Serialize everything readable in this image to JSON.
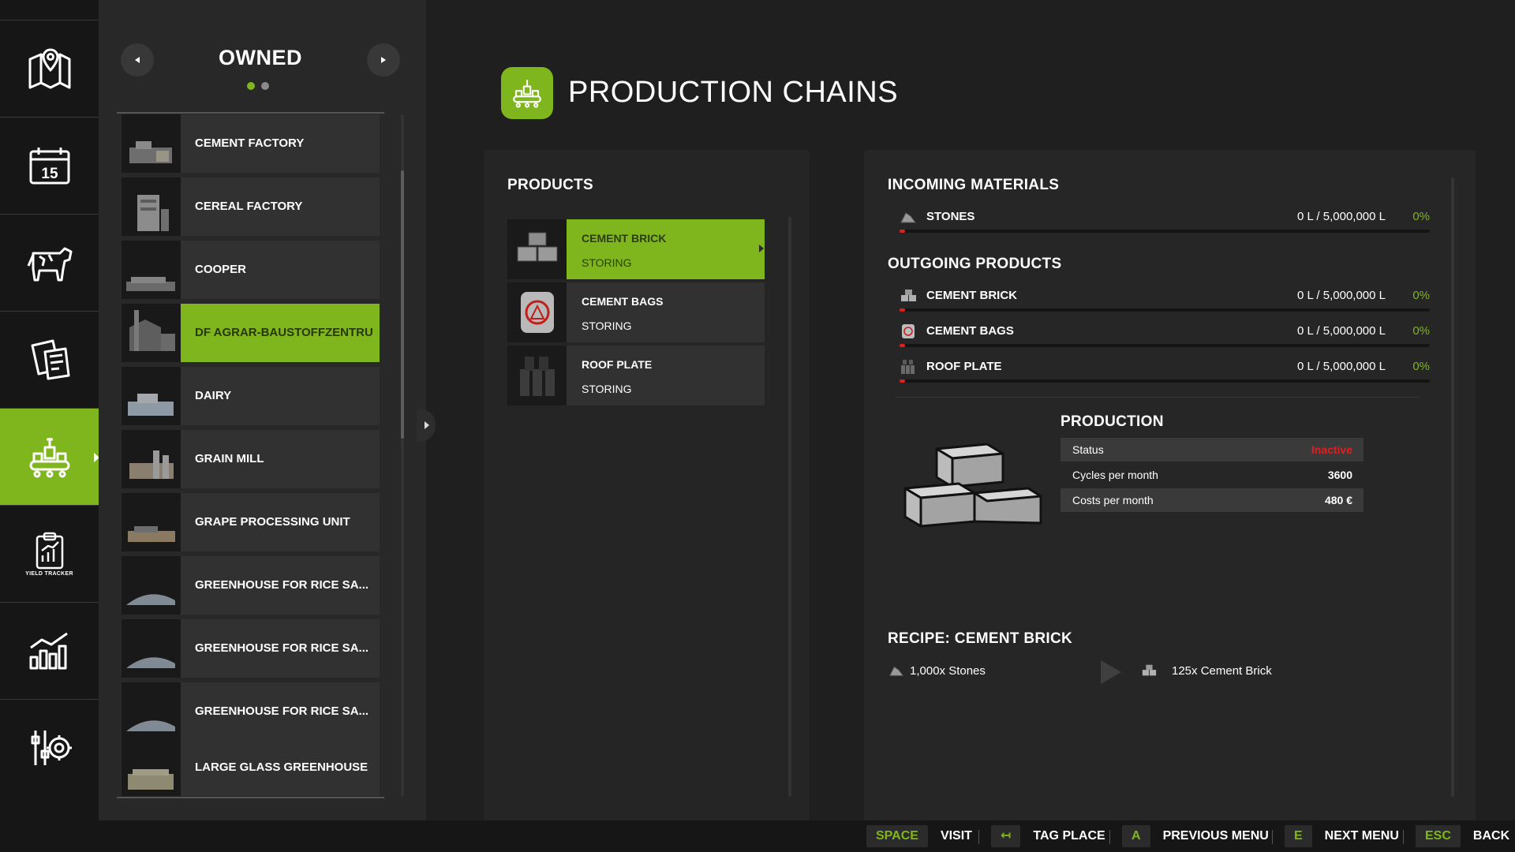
{
  "nav": {
    "items": [
      {
        "icon": "map-icon"
      },
      {
        "icon": "calendar-icon",
        "day": "15"
      },
      {
        "icon": "cow-icon"
      },
      {
        "icon": "contracts-icon"
      },
      {
        "icon": "production-icon",
        "active": true
      },
      {
        "icon": "yield-tracker-icon",
        "sublabel": "YIELD TRACKER"
      },
      {
        "icon": "statistics-icon"
      },
      {
        "icon": "settings-icon"
      }
    ]
  },
  "owned": {
    "title": "OWNED",
    "page_count": 2,
    "current_page": 1,
    "items": [
      {
        "label": "CEMENT FACTORY"
      },
      {
        "label": "CEREAL FACTORY"
      },
      {
        "label": "COOPER"
      },
      {
        "label": "DF AGRAR-BAUSTOFFZENTRU",
        "active": true
      },
      {
        "label": "DAIRY"
      },
      {
        "label": "GRAIN MILL"
      },
      {
        "label": "GRAPE PROCESSING UNIT"
      },
      {
        "label": "GREENHOUSE FOR RICE SA..."
      },
      {
        "label": "GREENHOUSE FOR RICE SA..."
      },
      {
        "label": "GREENHOUSE FOR RICE SA..."
      },
      {
        "label": "LARGE GLASS GREENHOUSE"
      }
    ]
  },
  "header": {
    "title": "PRODUCTION CHAINS",
    "icon": "production-chain-icon"
  },
  "products": {
    "title": "PRODUCTS",
    "items": [
      {
        "name": "CEMENT BRICK",
        "state": "STORING",
        "active": true,
        "icon": "cement-brick-icon"
      },
      {
        "name": "CEMENT BAGS",
        "state": "STORING",
        "icon": "cement-bags-icon"
      },
      {
        "name": "ROOF PLATE",
        "state": "STORING",
        "icon": "roof-plate-icon"
      }
    ]
  },
  "incoming": {
    "title": "INCOMING MATERIALS",
    "items": [
      {
        "name": "STONES",
        "amount": "0 L / 5,000,000 L",
        "percent": "0%",
        "fill": 0,
        "icon": "stones-icon"
      }
    ]
  },
  "outgoing": {
    "title": "OUTGOING PRODUCTS",
    "items": [
      {
        "name": "CEMENT BRICK",
        "amount": "0 L / 5,000,000 L",
        "percent": "0%",
        "fill": 0,
        "icon": "cement-brick-icon"
      },
      {
        "name": "CEMENT BAGS",
        "amount": "0 L / 5,000,000 L",
        "percent": "0%",
        "fill": 0,
        "icon": "cement-bags-icon"
      },
      {
        "name": "ROOF PLATE",
        "amount": "0 L / 5,000,000 L",
        "percent": "0%",
        "fill": 0,
        "icon": "roof-plate-icon"
      }
    ]
  },
  "production": {
    "title": "PRODUCTION",
    "rows": [
      {
        "key": "Status",
        "value": "Inactive",
        "status": "inactive"
      },
      {
        "key": "Cycles per month",
        "value": "3600"
      },
      {
        "key": "Costs per month",
        "value": "480 €"
      }
    ]
  },
  "recipe": {
    "title": "RECIPE: CEMENT BRICK",
    "input": "1,000x Stones",
    "output": "125x Cement Brick"
  },
  "footer": {
    "hints": [
      {
        "key": "SPACE",
        "label": "VISIT"
      },
      {
        "key": "↤",
        "label": "TAG PLACE"
      },
      {
        "key": "A",
        "label": "PREVIOUS MENU"
      },
      {
        "key": "E",
        "label": "NEXT MENU"
      },
      {
        "key": "ESC",
        "label": "BACK"
      }
    ]
  },
  "colors": {
    "accent": "#7fb51d",
    "inactive": "#e02020",
    "background": "#1f1f1f"
  }
}
